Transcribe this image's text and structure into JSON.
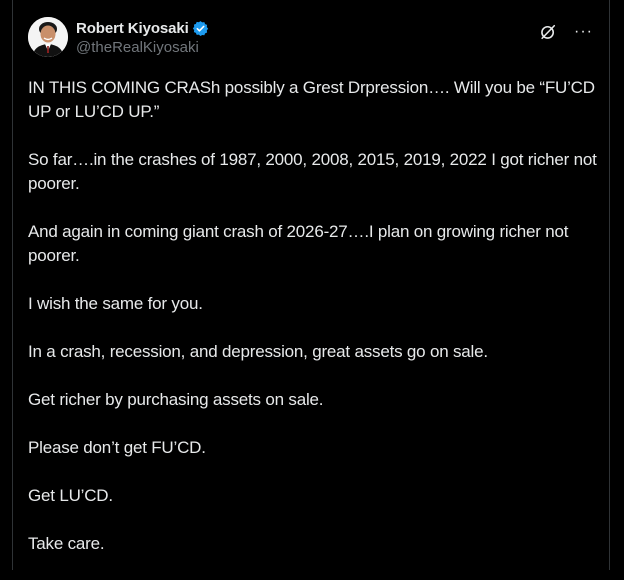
{
  "author": {
    "display_name": "Robert Kiyosaki",
    "handle": "@theRealKiyosaki",
    "verified": true
  },
  "icons": {
    "verified": "verified-badge-icon",
    "grok": "grok-icon",
    "more": "more-options-icon"
  },
  "colors": {
    "background": "#000000",
    "text": "#e7e9ea",
    "secondary_text": "#71767b",
    "verified_blue": "#1d9bf0"
  },
  "more_label": "···",
  "tweet": {
    "paragraphs": [
      "IN THIS COMING CRASh possibly a Grest Drpression…. Will you be “FU’CD UP or LU’CD UP.”",
      "So far….in the crashes of 1987, 2000, 2008, 2015, 2019, 2022 I got richer not poorer.",
      "And again in coming giant crash of 2026-27….I plan on growing richer not poorer.",
      "I wish the same for you.",
      "In a crash, recession, and depression, great assets go on sale.",
      "Get richer by purchasing assets on sale.",
      "Please don’t get FU’CD.",
      "Get LU’CD.",
      "Take care."
    ]
  }
}
